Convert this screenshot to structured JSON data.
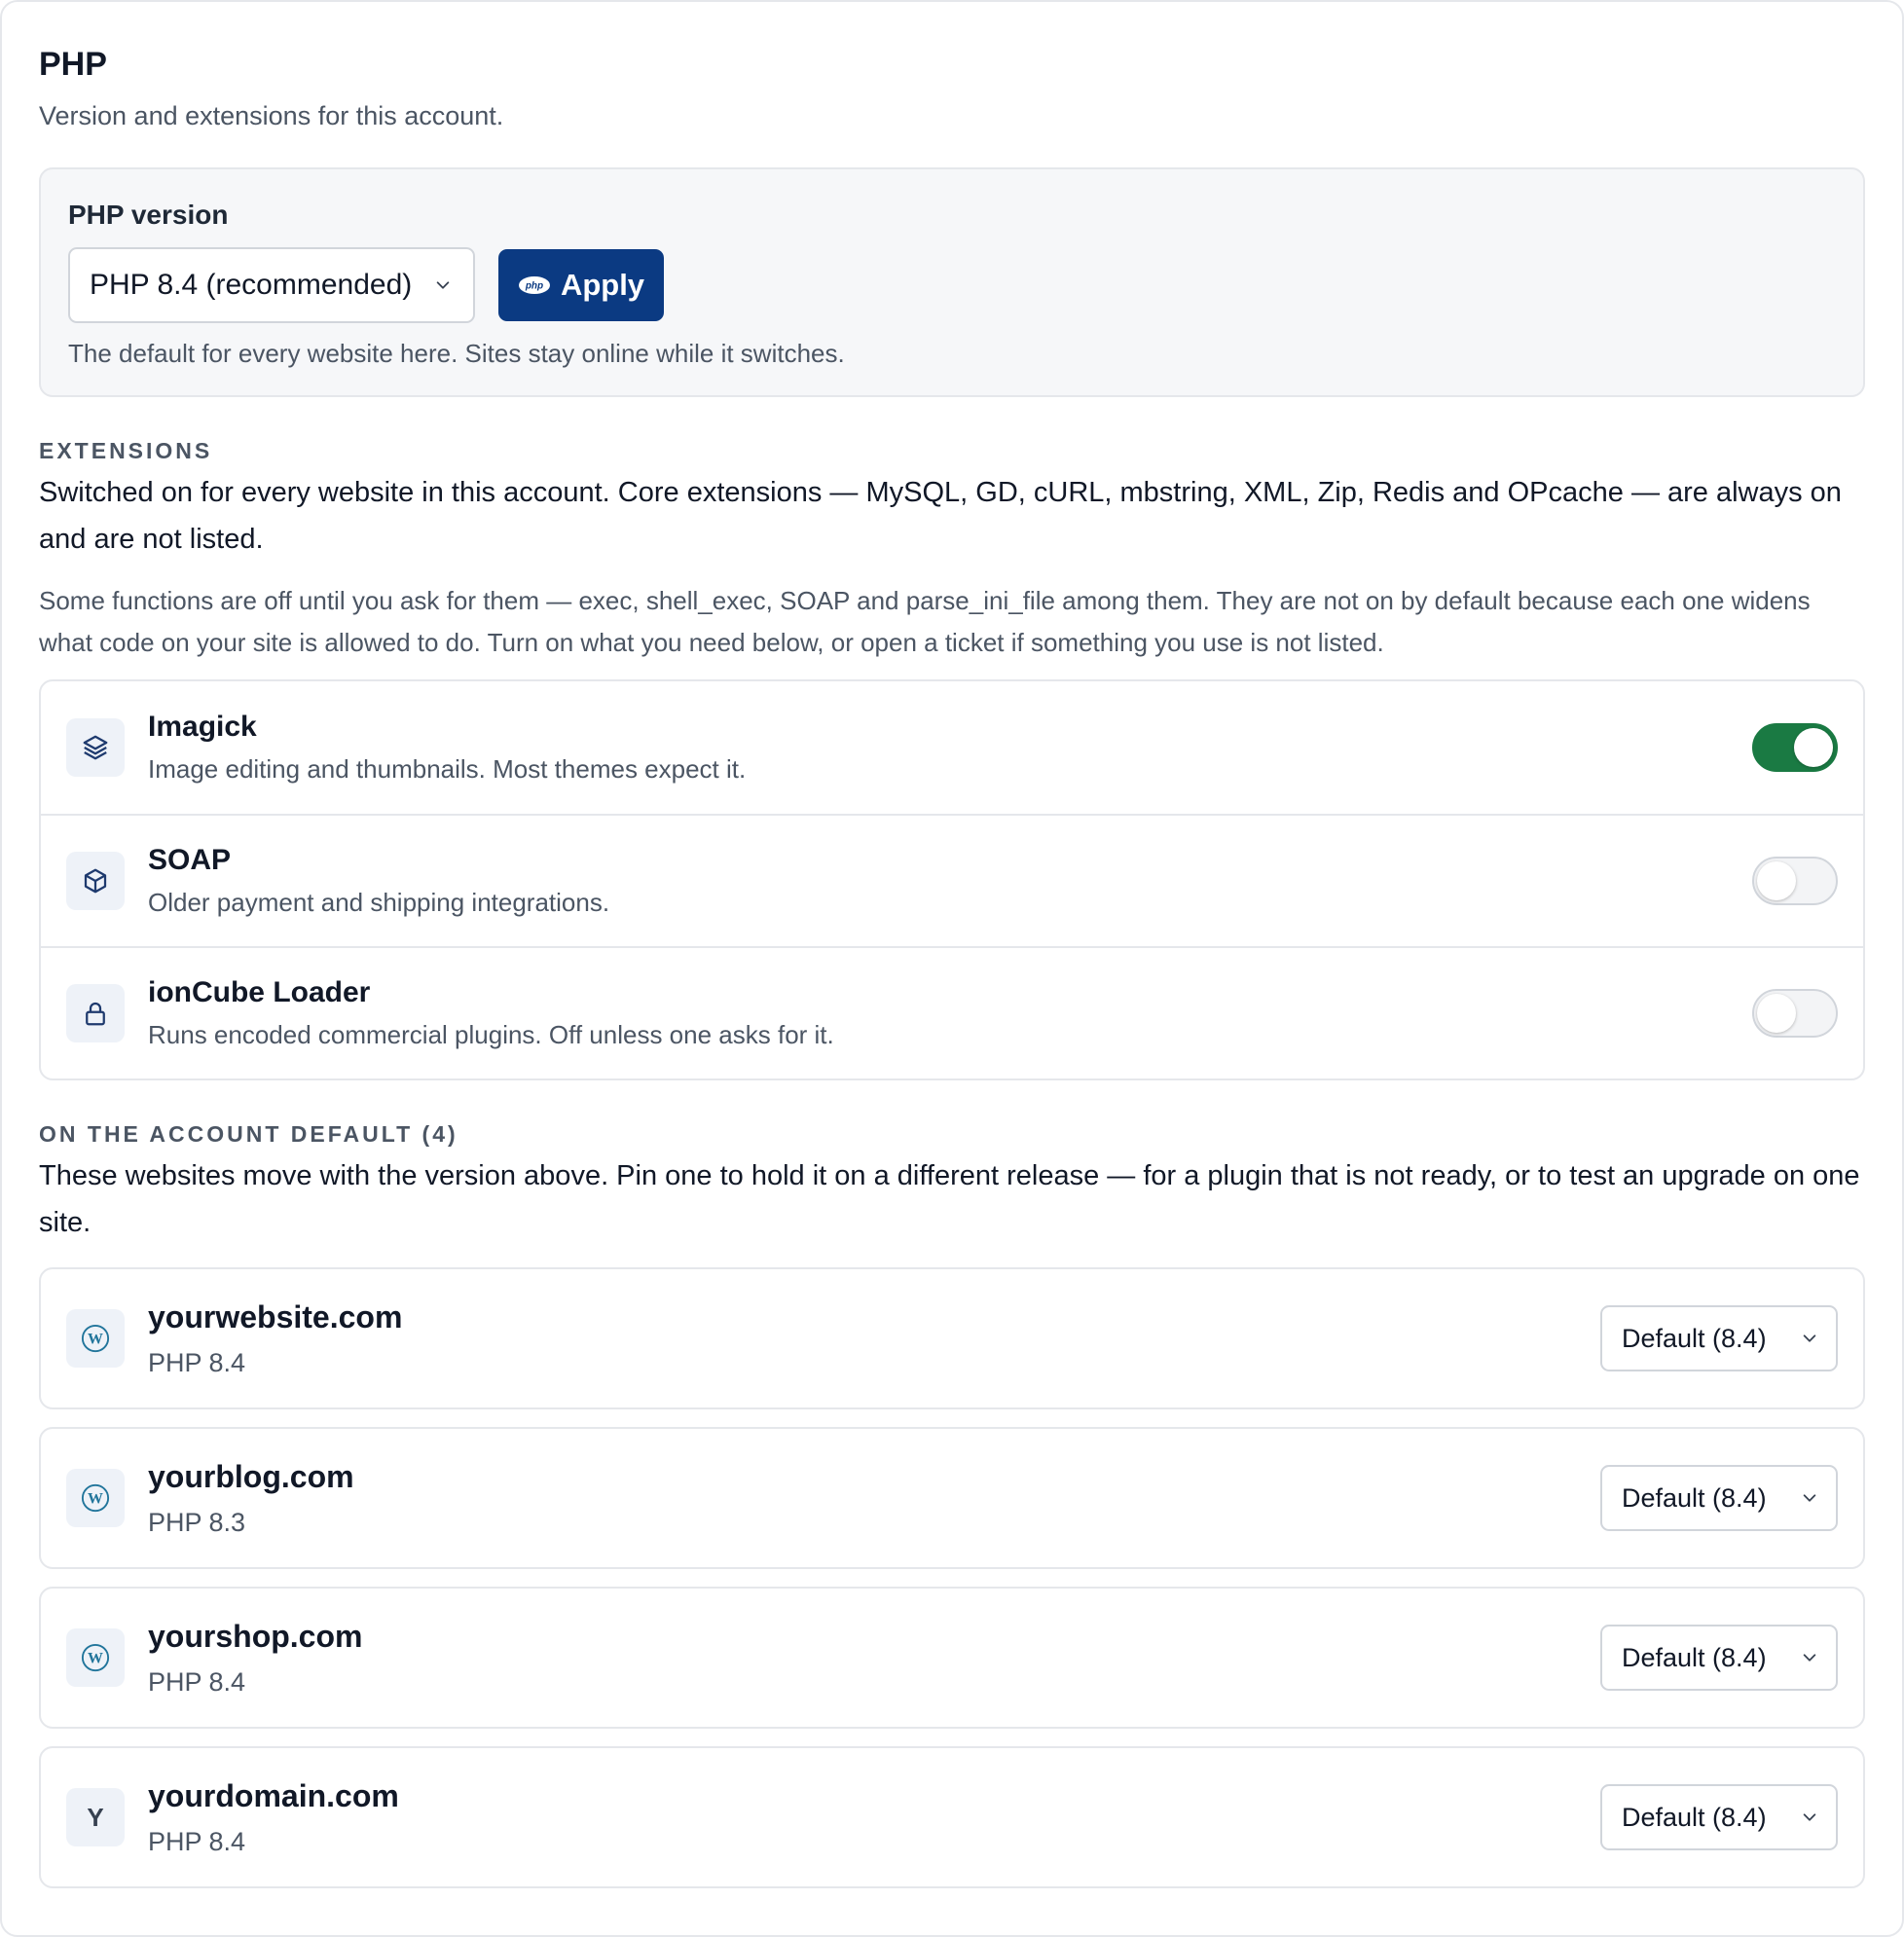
{
  "header": {
    "title": "PHP",
    "subtitle": "Version and extensions for this account."
  },
  "version": {
    "label": "PHP version",
    "selected": "PHP 8.4 (recommended)",
    "apply_label": "Apply",
    "help": "The default for every website here. Sites stay online while it switches."
  },
  "extensions": {
    "section_label": "EXTENSIONS",
    "description": "Switched on for every website in this account. Core extensions — MySQL, GD, cURL, mbstring, XML, Zip, Redis and OPcache — are always on and are not listed.",
    "note": "Some functions are off until you ask for them — exec, shell_exec, SOAP and parse_ini_file among them. They are not on by default because each one widens what code on your site is allowed to do. Turn on what you need below, or open a ticket if something you use is not listed.",
    "items": [
      {
        "name": "Imagick",
        "description": "Image editing and thumbnails. Most themes expect it.",
        "icon": "layers-icon",
        "enabled": true
      },
      {
        "name": "SOAP",
        "description": "Older payment and shipping integrations.",
        "icon": "box-icon",
        "enabled": false
      },
      {
        "name": "ionCube Loader",
        "description": "Runs encoded commercial plugins. Off unless one asks for it.",
        "icon": "lock-icon",
        "enabled": false
      }
    ]
  },
  "sites": {
    "section_label": "ON THE ACCOUNT DEFAULT (4)",
    "description": "These websites move with the version above. Pin one to hold it on a different release — for a plugin that is not ready, or to test an upgrade on one site.",
    "items": [
      {
        "name": "yourwebsite.com",
        "php": "PHP 8.4",
        "icon": "wordpress-icon",
        "selected": "Default (8.4)"
      },
      {
        "name": "yourblog.com",
        "php": "PHP 8.3",
        "icon": "wordpress-icon",
        "selected": "Default (8.4)"
      },
      {
        "name": "yourshop.com",
        "php": "PHP 8.4",
        "icon": "wordpress-icon",
        "selected": "Default (8.4)"
      },
      {
        "name": "yourdomain.com",
        "php": "PHP 8.4",
        "icon": "letter-icon",
        "letter": "Y",
        "selected": "Default (8.4)"
      }
    ]
  },
  "colors": {
    "accent": "#0b3a82",
    "toggle_on": "#1a7a43",
    "wordpress": "#21759b"
  }
}
